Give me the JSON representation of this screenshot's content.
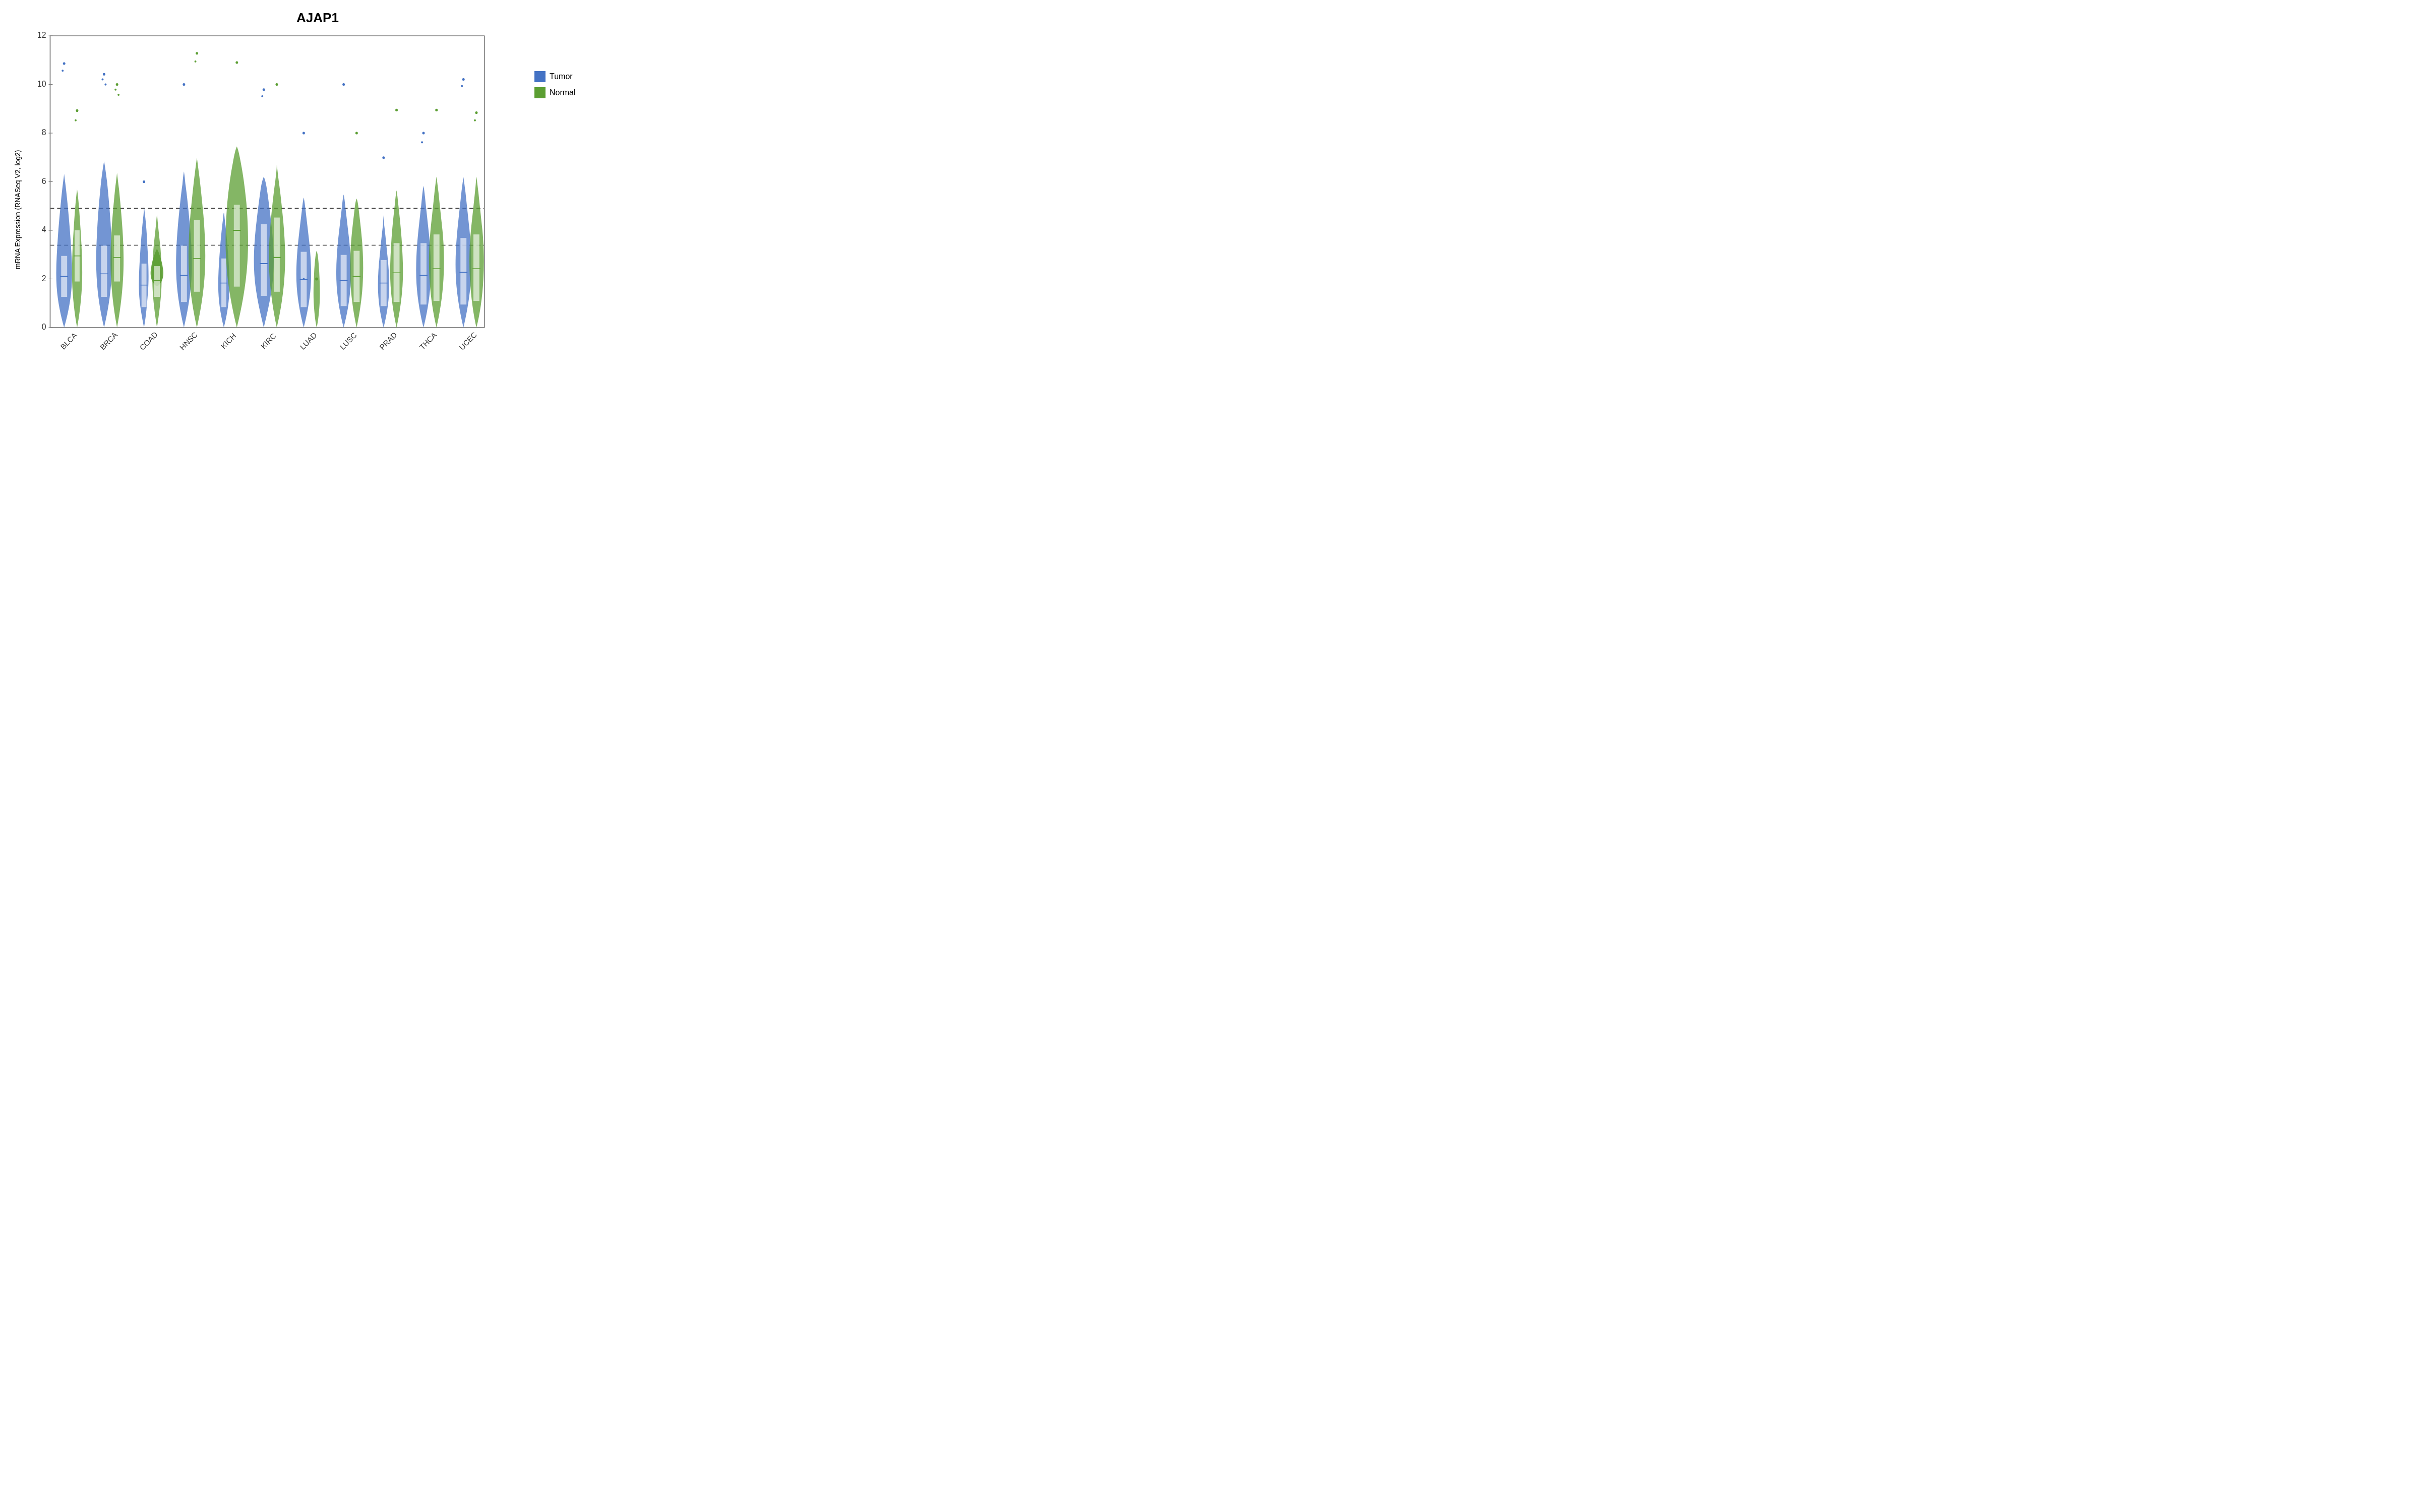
{
  "title": "AJAP1",
  "yAxisLabel": "mRNA Expression (RNASeq V2, log2)",
  "xLabels": [
    "BLCA",
    "BRCA",
    "COAD",
    "HNSC",
    "KICH",
    "KIRC",
    "LUAD",
    "LUSC",
    "PRAD",
    "THCA",
    "UCEC"
  ],
  "yTicks": [
    0,
    2,
    4,
    6,
    8,
    10,
    12
  ],
  "dottedLines": [
    3.4,
    4.9
  ],
  "legend": {
    "items": [
      {
        "label": "Tumor",
        "color": "#4472C4"
      },
      {
        "label": "Normal",
        "color": "#548235"
      }
    ]
  },
  "tumorColor": "#4472C4",
  "normalColor": "#70AD47",
  "colors": {
    "tumor": "#4472C4",
    "normal": "#5B9E32"
  }
}
